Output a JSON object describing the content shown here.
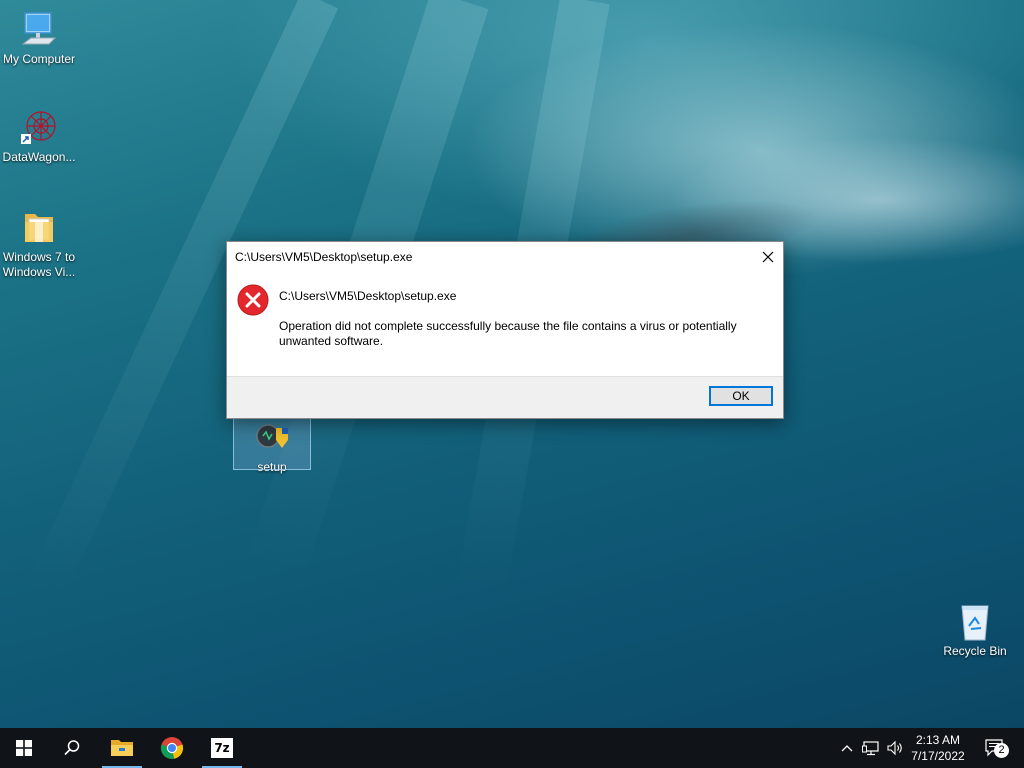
{
  "desktop": {
    "icons": [
      {
        "label": "My Computer",
        "icon": "computer-icon"
      },
      {
        "label": "DataWagon...",
        "icon": "datawagon-icon"
      },
      {
        "label": "Windows 7 to Windows Vi...",
        "label_line1": "Windows 7 to",
        "label_line2": "Windows Vi...",
        "icon": "folder-icon"
      },
      {
        "label": "setup",
        "icon": "setup-installer-icon"
      },
      {
        "label": "Recycle Bin",
        "icon": "recycle-bin-icon"
      }
    ]
  },
  "dialog": {
    "title": "C:\\Users\\VM5\\Desktop\\setup.exe",
    "path": "C:\\Users\\VM5\\Desktop\\setup.exe",
    "message": "Operation did not complete successfully because the file contains a virus or potentially unwanted software.",
    "ok_label": "OK",
    "icon": "error-icon",
    "accent": "#0078d7",
    "error_color": "#e81123"
  },
  "taskbar": {
    "buttons": [
      {
        "name": "start",
        "icon": "windows-start-icon"
      },
      {
        "name": "search",
        "icon": "search-icon"
      },
      {
        "name": "file-explorer",
        "icon": "file-explorer-icon"
      },
      {
        "name": "chrome",
        "icon": "chrome-icon"
      },
      {
        "name": "7zip",
        "icon": "7zip-icon",
        "label": "7z"
      }
    ],
    "tray": {
      "icons": [
        "chevron-up-icon",
        "network-icon",
        "volume-icon"
      ],
      "time": "2:13 AM",
      "date": "7/17/2022",
      "notification_count": "2"
    }
  }
}
